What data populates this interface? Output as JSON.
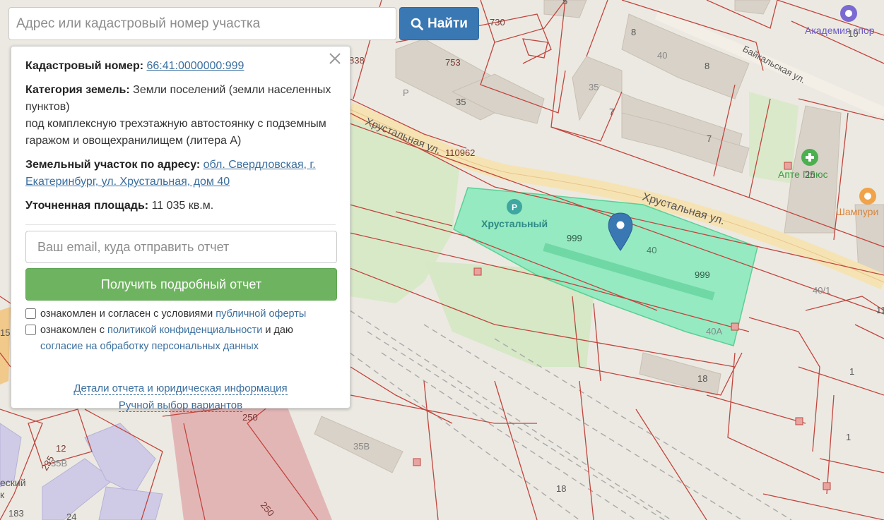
{
  "search": {
    "placeholder": "Адрес или кадастровый номер участка",
    "button_label": "Найти"
  },
  "panel": {
    "cadastral_label": "Кадастровый номер:",
    "cadastral_value": "66:41:0000000:999",
    "category_label": "Категория земель:",
    "category_value": "Земли поселений (земли населенных пунктов)",
    "usage_text": "под комплексную трехэтажную автостоянку с подземным гаражом и овощехранилищем (литера А)",
    "address_label": "Земельный участок по адресу:",
    "address_value": "обл. Свердловская, г. Екатеринбург, ул. Хрустальная, дом 40",
    "area_label": "Уточненная площадь:",
    "area_value": "11 035 кв.м.",
    "email_placeholder": "Ваш email, куда отправить отчет",
    "report_button": "Получить подробный отчет",
    "offer_text": "ознакомлен и согласен с условиями ",
    "offer_link": "публичной оферты",
    "privacy_text_1": "ознакомлен с ",
    "privacy_link": "политикой конфиденциальности",
    "privacy_text_2": " и даю ",
    "consent_link": "согласие на обработку персональных данных",
    "details_link": "Детали отчета и юридическая информация",
    "manual_link": "Ручной выбор вариантов"
  },
  "map": {
    "street_1": "Хрустальная ул.",
    "street_2": "Хрустальная ул.",
    "street_3": "Байкальская ул.",
    "poi_parking": "Хрустальный",
    "poi_pharmacy": "Апте Плюс",
    "poi_cafe": "Шампури",
    "poi_academy": "Академия спор",
    "poi_partial": "еский",
    "poi_partial_2": "к",
    "labels": [
      "730",
      "753",
      "35",
      "8",
      "40",
      "8",
      "35",
      "7",
      "7",
      "10",
      "5",
      "110962",
      "999",
      "40",
      "999",
      "40/1",
      "40А",
      "18",
      "25",
      "1",
      "1",
      "250",
      "250",
      "35В",
      "18",
      "12",
      "235",
      "35В",
      "183",
      "24",
      "15",
      "Р",
      "838",
      "11"
    ]
  },
  "colors": {
    "accent": "#3a78b4",
    "success": "#6eb35f",
    "parcel": "#7ceab8",
    "boundary": "#c0463e",
    "link": "#3b6f9e"
  },
  "icons": {
    "search": "search-icon",
    "close": "close-icon",
    "marker": "map-marker-icon",
    "parking": "parking-icon",
    "pharmacy": "pharmacy-icon",
    "cafe": "cafe-icon",
    "academy": "academy-icon"
  }
}
